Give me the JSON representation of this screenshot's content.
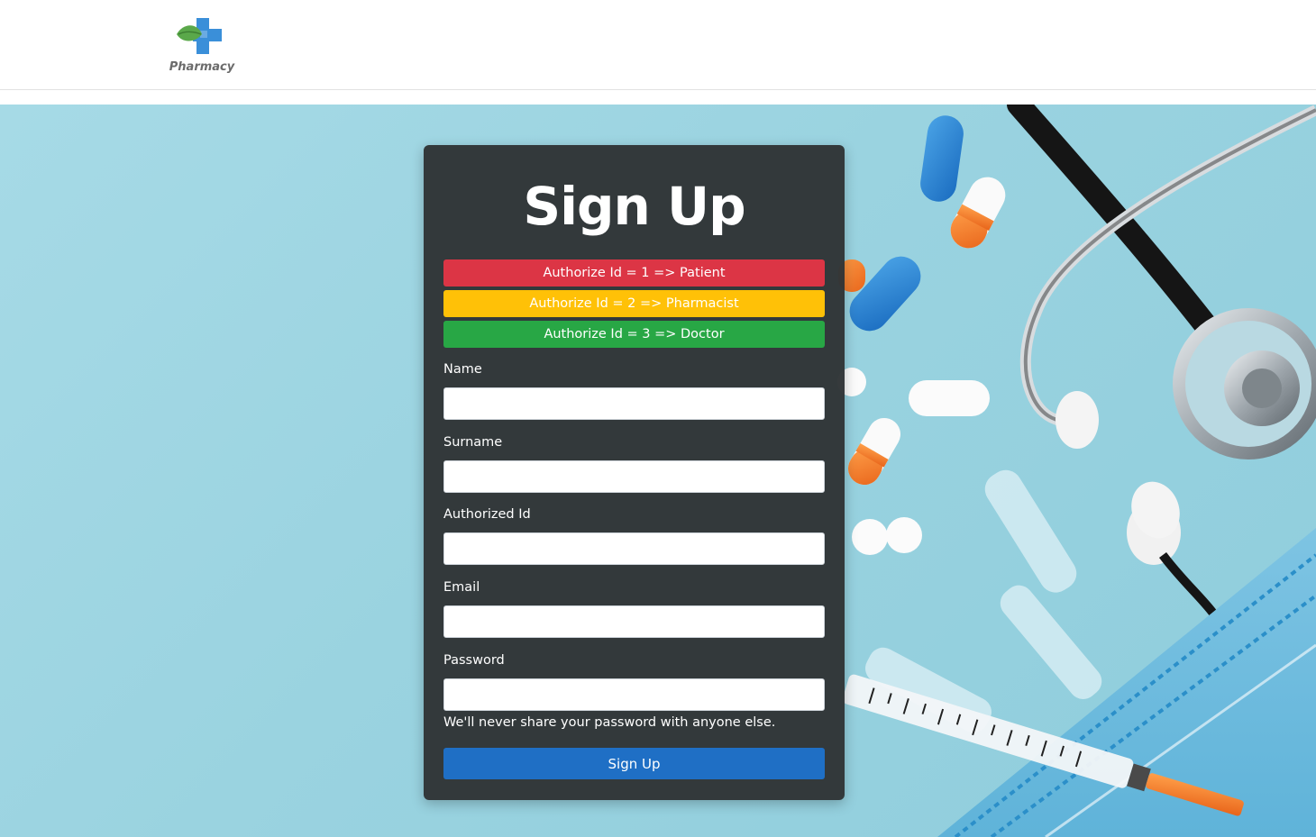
{
  "brand": {
    "name": "Pharmacy",
    "logo_icon": "pharmacy-cross-leaf-icon"
  },
  "form": {
    "title": "Sign Up",
    "roles": [
      {
        "label": "Authorize Id = 1 => Patient",
        "color": "#dc3545"
      },
      {
        "label": "Authorize Id = 2 => Pharmacist",
        "color": "#ffc107"
      },
      {
        "label": "Authorize Id = 3 => Doctor",
        "color": "#28a745"
      }
    ],
    "fields": {
      "name": {
        "label": "Name",
        "value": ""
      },
      "surname": {
        "label": "Surname",
        "value": ""
      },
      "authorized_id": {
        "label": "Authorized Id",
        "value": ""
      },
      "email": {
        "label": "Email",
        "value": ""
      },
      "password": {
        "label": "Password",
        "value": ""
      }
    },
    "password_help": "We'll never share your password with anyone else.",
    "submit_label": "Sign Up"
  },
  "colors": {
    "card_bg": "#2f3436",
    "submit": "#1f6fc5",
    "hero_bg": "#9ad3e0"
  }
}
